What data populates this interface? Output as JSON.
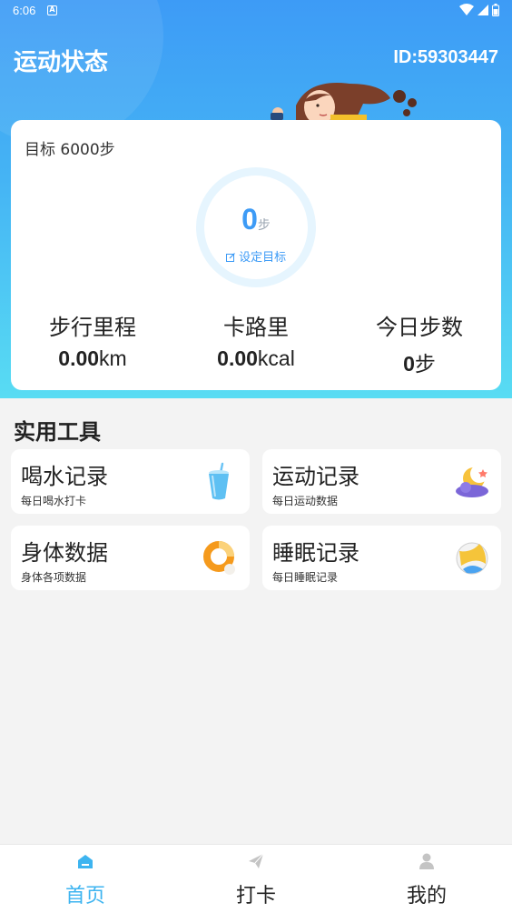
{
  "status_bar": {
    "time": "6:06",
    "notif_letter": "A"
  },
  "header": {
    "title": "运动状态",
    "id_text": "ID:59303447"
  },
  "goal_card": {
    "goal_text": "目标 6000步",
    "current_steps": "0",
    "steps_unit": "步",
    "set_goal_label": "设定目标",
    "stats": [
      {
        "label": "步行里程",
        "value": "0.00",
        "unit": "km"
      },
      {
        "label": "卡路里",
        "value": "0.00",
        "unit": "kcal"
      },
      {
        "label": "今日步数",
        "value": "0",
        "unit": "步"
      }
    ]
  },
  "tools_section": {
    "title": "实用工具",
    "items": [
      {
        "title": "喝水记录",
        "subtitle": "每日喝水打卡",
        "icon": "drink-cup-icon"
      },
      {
        "title": "运动记录",
        "subtitle": "每日运动数据",
        "icon": "moon-cloud-icon"
      },
      {
        "title": "身体数据",
        "subtitle": "身体各项数据",
        "icon": "donut-ring-icon"
      },
      {
        "title": "睡眠记录",
        "subtitle": "每日睡眠记录",
        "icon": "volleyball-icon"
      }
    ]
  },
  "tabbar": {
    "tabs": [
      {
        "label": "首页",
        "icon": "home-icon",
        "active": true
      },
      {
        "label": "打卡",
        "icon": "paper-plane-icon",
        "active": false
      },
      {
        "label": "我的",
        "icon": "person-icon",
        "active": false
      }
    ]
  },
  "colors": {
    "primary": "#3d9bf6",
    "tab_active": "#3db4f0",
    "hero_bottom": "#58dcf3"
  }
}
